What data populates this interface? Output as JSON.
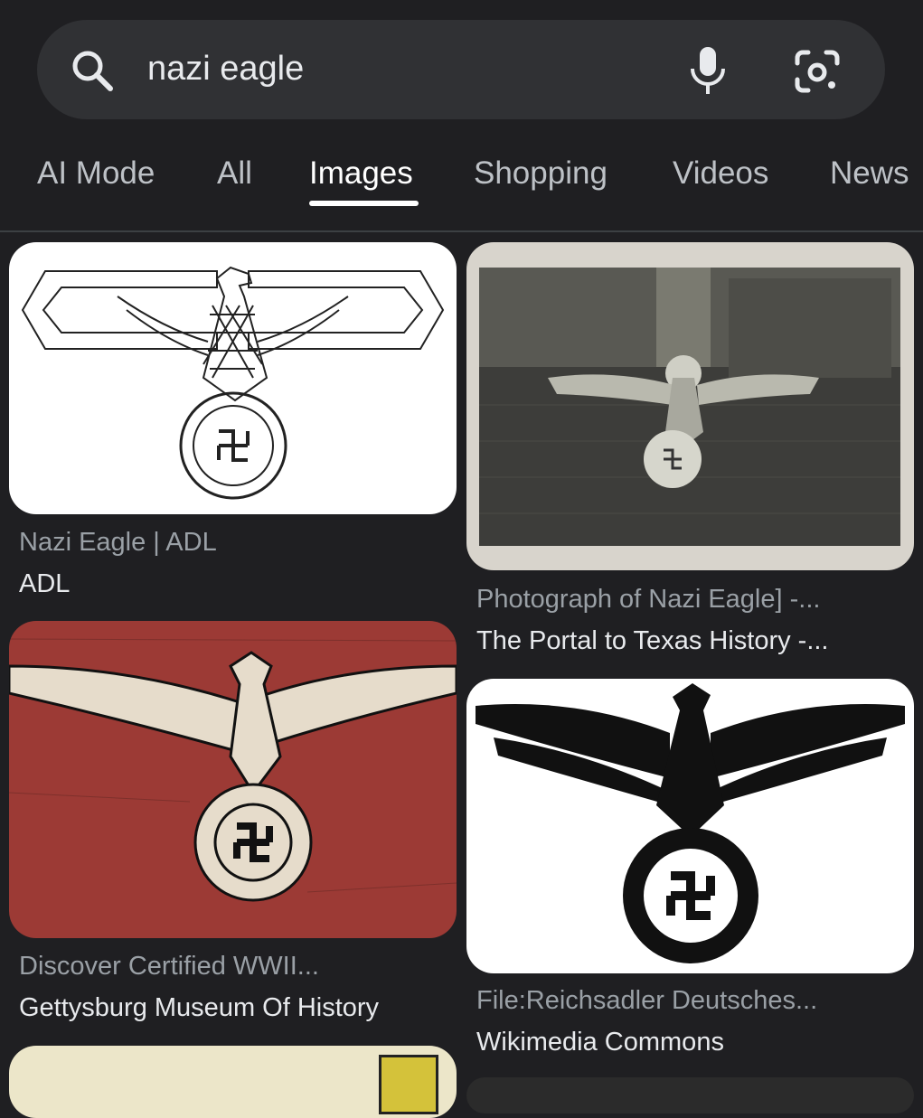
{
  "search": {
    "query": "nazi eagle"
  },
  "tabs": [
    {
      "label": "AI Mode"
    },
    {
      "label": "All"
    },
    {
      "label": "Images",
      "active": true
    },
    {
      "label": "Shopping"
    },
    {
      "label": "Videos"
    },
    {
      "label": "News"
    }
  ],
  "results": [
    {
      "title": "Nazi Eagle | ADL",
      "source": "ADL",
      "image": "line-drawing-eagle-emblem"
    },
    {
      "title": "Photograph of Nazi Eagle] -...",
      "source": "The Portal to Texas History -...",
      "image": "black-and-white-photo-eagle-statue"
    },
    {
      "title": "Discover Certified WWII...",
      "source": "Gettysburg Museum Of History",
      "image": "eagle-emblem-on-red-flag"
    },
    {
      "title": "File:Reichsadler Deutsches...",
      "source": "Wikimedia Commons",
      "image": "black-eagle-emblem"
    }
  ],
  "colors": {
    "background": "#1f1f22",
    "searchbar": "#303134",
    "tab_inactive": "#bdc1c6",
    "tab_active": "#ffffff",
    "caption_title": "#9aa0a6",
    "caption_source": "#e8eaed"
  }
}
